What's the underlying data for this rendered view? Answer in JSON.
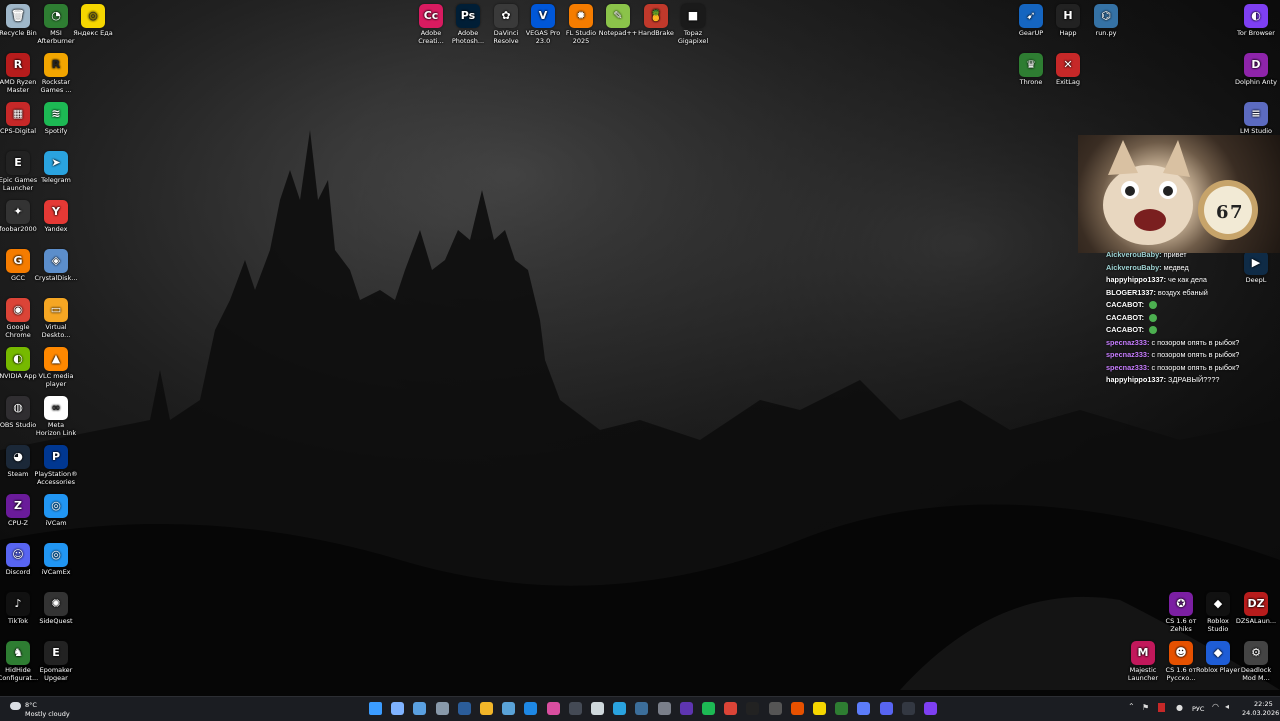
{
  "desktop_icons": [
    {
      "id": "recycle-bin",
      "label": "Recycle Bin",
      "color": "#9fb7c9",
      "glyph": "🗑"
    },
    {
      "id": "msi-afterburner",
      "label": "MSI\nAfterburner",
      "color": "#2e7d32",
      "glyph": "◔"
    },
    {
      "id": "yandex-eda",
      "label": "Яндекс Еда",
      "color": "#f5d600",
      "glyph": "◎"
    },
    {
      "id": "amd-ryzen-master",
      "label": "AMD Ryzen\nMaster",
      "color": "#b71c1c",
      "glyph": "R"
    },
    {
      "id": "rockstar-games",
      "label": "Rockstar\nGames ...",
      "color": "#f2a500",
      "glyph": "R"
    },
    {
      "id": "cps-digital",
      "label": "CPS-Digital",
      "color": "#c62828",
      "glyph": "▦"
    },
    {
      "id": "spotify",
      "label": "Spotify",
      "color": "#1db954",
      "glyph": "≋"
    },
    {
      "id": "epic-games",
      "label": "Epic Games\nLauncher",
      "color": "#222222",
      "glyph": "E"
    },
    {
      "id": "telegram",
      "label": "Telegram",
      "color": "#2aa3df",
      "glyph": "➤"
    },
    {
      "id": "foobar2000",
      "label": "foobar2000",
      "color": "#333333",
      "glyph": "✦"
    },
    {
      "id": "yandex",
      "label": "Yandex",
      "color": "#e53935",
      "glyph": "Y"
    },
    {
      "id": "gcc",
      "label": "GCC",
      "color": "#f57c00",
      "glyph": "G"
    },
    {
      "id": "crystaldisk",
      "label": "CrystalDisk...",
      "color": "#5c8ecb",
      "glyph": "◈"
    },
    {
      "id": "google-chrome",
      "label": "Google\nChrome",
      "color": "#db4437",
      "glyph": "◉"
    },
    {
      "id": "virtual-desktop",
      "label": "Virtual\nDeskto...",
      "color": "#f5a623",
      "glyph": "▭"
    },
    {
      "id": "nvidia-app",
      "label": "NVIDIA App",
      "color": "#76b900",
      "glyph": "◐"
    },
    {
      "id": "vlc",
      "label": "VLC media\nplayer",
      "color": "#ff8800",
      "glyph": "▲"
    },
    {
      "id": "obs-studio",
      "label": "OBS Studio",
      "color": "#302e31",
      "glyph": "◍"
    },
    {
      "id": "meta-horizon-link",
      "label": "Meta\nHorizon Link",
      "color": "#ffffff",
      "glyph": "∞"
    },
    {
      "id": "steam",
      "label": "Steam",
      "color": "#1b2838",
      "glyph": "◕"
    },
    {
      "id": "playstation-accessories",
      "label": "PlayStation®\nAccessories",
      "color": "#003791",
      "glyph": "P"
    },
    {
      "id": "cpu-z",
      "label": "CPU-Z",
      "color": "#6a1b9a",
      "glyph": "Z"
    },
    {
      "id": "ivcam",
      "label": "iVCam",
      "color": "#2196f3",
      "glyph": "◎"
    },
    {
      "id": "discord",
      "label": "Discord",
      "color": "#5865f2",
      "glyph": "☺"
    },
    {
      "id": "ivcamex",
      "label": "iVCamEx",
      "color": "#2196f3",
      "glyph": "◎"
    },
    {
      "id": "tiktok",
      "label": "TikTok",
      "color": "#111111",
      "glyph": "♪"
    },
    {
      "id": "sidequest",
      "label": "SideQuest",
      "color": "#333333",
      "glyph": "✺"
    },
    {
      "id": "hidhide",
      "label": "HidHide\nConfigurat...",
      "color": "#2e7d32",
      "glyph": "♞"
    },
    {
      "id": "epomaker",
      "label": "Epomaker\nUpgear",
      "color": "#222222",
      "glyph": "E"
    },
    {
      "id": "adobe-creative",
      "label": "Adobe\nCreati...",
      "color": "#d81b60",
      "glyph": "Cc"
    },
    {
      "id": "adobe-photoshop",
      "label": "Adobe\nPhotosh...",
      "color": "#001e36",
      "glyph": "Ps"
    },
    {
      "id": "davinci-resolve",
      "label": "DaVinci\nResolve",
      "color": "#3a3a3a",
      "glyph": "✿"
    },
    {
      "id": "vegas-pro",
      "label": "VEGAS Pro\n23.0",
      "color": "#0057d8",
      "glyph": "V"
    },
    {
      "id": "fl-studio",
      "label": "FL Studio\n2025",
      "color": "#f57c00",
      "glyph": "✹"
    },
    {
      "id": "notepad-plus",
      "label": "Notepad++",
      "color": "#8bc34a",
      "glyph": "✎"
    },
    {
      "id": "handbrake",
      "label": "HandBrake",
      "color": "#c0392b",
      "glyph": "🍍"
    },
    {
      "id": "topaz-gigapixel",
      "label": "Topaz\nGigapixel",
      "color": "#1a1a1a",
      "glyph": "■"
    },
    {
      "id": "gearup",
      "label": "GearUP",
      "color": "#1565c0",
      "glyph": "➹"
    },
    {
      "id": "happ",
      "label": "Happ",
      "color": "#222222",
      "glyph": "H"
    },
    {
      "id": "run-py",
      "label": "run.py",
      "color": "#3572a5",
      "glyph": "⌬"
    },
    {
      "id": "throne",
      "label": "Throne",
      "color": "#2e7d32",
      "glyph": "♛"
    },
    {
      "id": "exitlag",
      "label": "ExitLag",
      "color": "#c62828",
      "glyph": "✕"
    },
    {
      "id": "tor-browser",
      "label": "Tor Browser",
      "color": "#7e3ff2",
      "glyph": "◐"
    },
    {
      "id": "dolphin-anty",
      "label": "Dolphin Anty",
      "color": "#8e24aa",
      "glyph": "D"
    },
    {
      "id": "lm-studio",
      "label": "LM Studio",
      "color": "#5c6bc0",
      "glyph": "≡"
    },
    {
      "id": "deepl",
      "label": "DeepL",
      "color": "#0f2b46",
      "glyph": "▶"
    },
    {
      "id": "cs-zehiks",
      "label": "CS 1.6 от\nZehiks",
      "color": "#7b1fa2",
      "glyph": "✪"
    },
    {
      "id": "roblox-studio",
      "label": "Roblox\nStudio",
      "color": "#111111",
      "glyph": "◆"
    },
    {
      "id": "dzsa-launcher",
      "label": "DZSALaun...",
      "color": "#b71c1c",
      "glyph": "DZ"
    },
    {
      "id": "majestic-launcher",
      "label": "Majestic\nLauncher",
      "color": "#c2185b",
      "glyph": "M"
    },
    {
      "id": "cs-russian",
      "label": "CS 1.6 от\nРусско...",
      "color": "#e65100",
      "glyph": "☻"
    },
    {
      "id": "roblox-player",
      "label": "Roblox Player",
      "color": "#1e5dd6",
      "glyph": "◆"
    },
    {
      "id": "deadlock-mod",
      "label": "Deadlock\nMod M...",
      "color": "#444444",
      "glyph": "⚙"
    }
  ],
  "chat": [
    {
      "user": "AickverouBaby:",
      "message": "привет",
      "color": "#9fd4d4",
      "emote": false
    },
    {
      "user": "AickverouBaby:",
      "message": "медвед",
      "color": "#9fd4d4",
      "emote": false
    },
    {
      "user": "happyhippo1337:",
      "message": "че как дела",
      "color": "#ffffff",
      "emote": false
    },
    {
      "user": "BLOGER1337:",
      "message": "воздух ебаный",
      "color": "#ffffff",
      "emote": false
    },
    {
      "user": "CACABOT:",
      "message": "",
      "color": "#ffffff",
      "emote": true
    },
    {
      "user": "CACABOT:",
      "message": "",
      "color": "#ffffff",
      "emote": true
    },
    {
      "user": "CACABOT:",
      "message": "",
      "color": "#ffffff",
      "emote": true
    },
    {
      "user": "specnaz333:",
      "message": "с позором опять в рыбок?",
      "color": "#c77dff",
      "emote": false
    },
    {
      "user": "specnaz333:",
      "message": "с позором опять в рыбок?",
      "color": "#c77dff",
      "emote": false
    },
    {
      "user": "specnaz333:",
      "message": "с позором опять в рыбок?",
      "color": "#c77dff",
      "emote": false
    },
    {
      "user": "happyhippo1337:",
      "message": "ЗДРАВЫЙ????",
      "color": "#ffffff",
      "emote": false
    }
  ],
  "weather": {
    "temp": "8°C",
    "desc": "Mostly cloudy"
  },
  "tray": {
    "lang": "РУС",
    "time": "22:25",
    "date": "24.03.2026"
  },
  "taskbar_apps": [
    {
      "id": "start",
      "color": "#3b9cff"
    },
    {
      "id": "search",
      "color": "#7fb3ff"
    },
    {
      "id": "task-view",
      "color": "#5aa0e0"
    },
    {
      "id": "widgets",
      "color": "#8899aa"
    },
    {
      "id": "terminal",
      "color": "#2b5d9a"
    },
    {
      "id": "file-explorer",
      "color": "#f2b629"
    },
    {
      "id": "photos",
      "color": "#5aa3d8"
    },
    {
      "id": "mail",
      "color": "#1e88e5"
    },
    {
      "id": "app-pink",
      "color": "#d94ea0"
    },
    {
      "id": "app-dark",
      "color": "#444a55"
    },
    {
      "id": "store",
      "color": "#cfd8dc"
    },
    {
      "id": "telegram",
      "color": "#2aa3df"
    },
    {
      "id": "steam",
      "color": "#3c6e9a"
    },
    {
      "id": "settings",
      "color": "#7a7f8a"
    },
    {
      "id": "app-z",
      "color": "#5e35b1"
    },
    {
      "id": "spotify",
      "color": "#1db954"
    },
    {
      "id": "chrome",
      "color": "#db4437"
    },
    {
      "id": "app-black",
      "color": "#222222"
    },
    {
      "id": "obs",
      "color": "#555555"
    },
    {
      "id": "app-orange",
      "color": "#e65100"
    },
    {
      "id": "yandex-eda",
      "color": "#f5d600"
    },
    {
      "id": "throne",
      "color": "#2e7d32"
    },
    {
      "id": "app-blue",
      "color": "#5c7cfa"
    },
    {
      "id": "discord",
      "color": "#5865f2"
    },
    {
      "id": "app-grey",
      "color": "#333842"
    },
    {
      "id": "tor",
      "color": "#7e3ff2"
    }
  ]
}
